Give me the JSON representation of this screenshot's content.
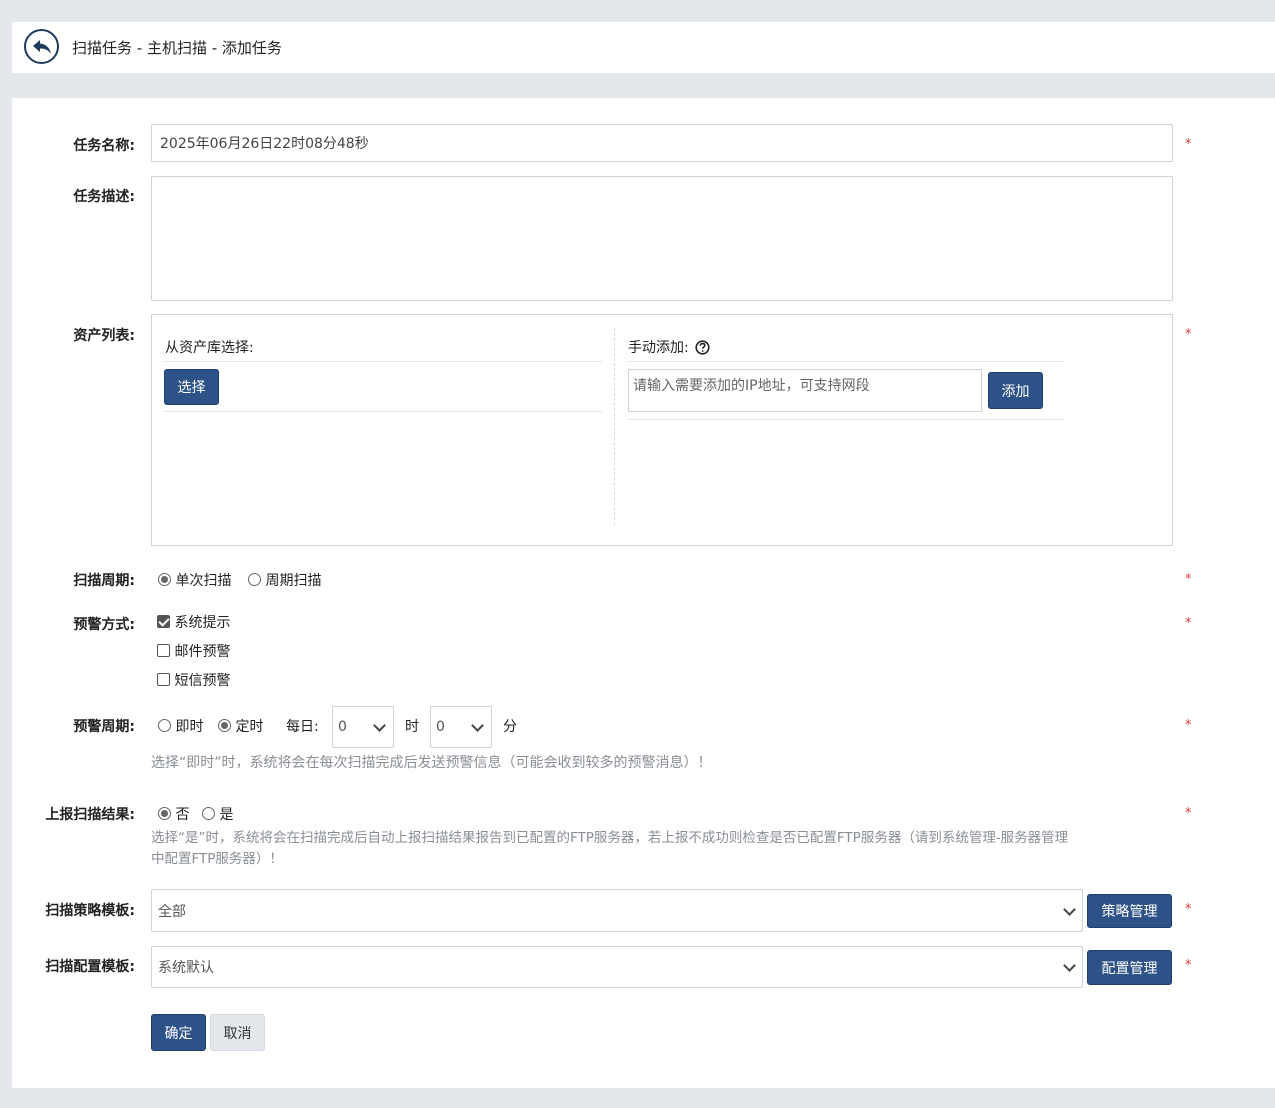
{
  "header": {
    "title": "扫描任务 - 主机扫描 - 添加任务"
  },
  "form": {
    "required_mark": "*",
    "task_name": {
      "label": "任务名称:",
      "value": "2025年06月26日22时08分48秒"
    },
    "task_desc": {
      "label": "任务描述:",
      "value": ""
    },
    "asset_list": {
      "label": "资产列表:",
      "from_library_label": "从资产库选择:",
      "select_button": "选择",
      "manual_label": "手动添加:",
      "manual_placeholder": "请输入需要添加的IP地址，可支持网段",
      "add_button": "添加"
    },
    "scan_cycle": {
      "label": "扫描周期:",
      "options": [
        "单次扫描",
        "周期扫描"
      ],
      "selected": "单次扫描"
    },
    "alert_method": {
      "label": "预警方式:",
      "options": [
        {
          "label": "系统提示",
          "checked": true
        },
        {
          "label": "邮件预警",
          "checked": false
        },
        {
          "label": "短信预警",
          "checked": false
        }
      ]
    },
    "alert_cycle": {
      "label": "预警周期:",
      "options": [
        "即时",
        "定时"
      ],
      "selected": "定时",
      "daily_label": "每日:",
      "hour_value": "0",
      "hour_unit": "时",
      "minute_value": "0",
      "minute_unit": "分",
      "hint": "选择“即时”时，系统将会在每次扫描完成后发送预警信息（可能会收到较多的预警消息）！"
    },
    "report_result": {
      "label": "上报扫描结果:",
      "options": [
        "否",
        "是"
      ],
      "selected": "否",
      "hint_line1": "选择“是”时，系统将会在扫描完成后自动上报扫描结果报告到已配置的FTP服务器，若上报不成功则检查是否已配置FTP服务器（请到系统管理-服务器管理",
      "hint_line2": "中配置FTP服务器）！"
    },
    "strategy_template": {
      "label": "扫描策略模板:",
      "value": "全部",
      "manage_button": "策略管理"
    },
    "config_template": {
      "label": "扫描配置模板:",
      "value": "系统默认",
      "manage_button": "配置管理"
    },
    "confirm_button": "确定",
    "cancel_button": "取消"
  }
}
